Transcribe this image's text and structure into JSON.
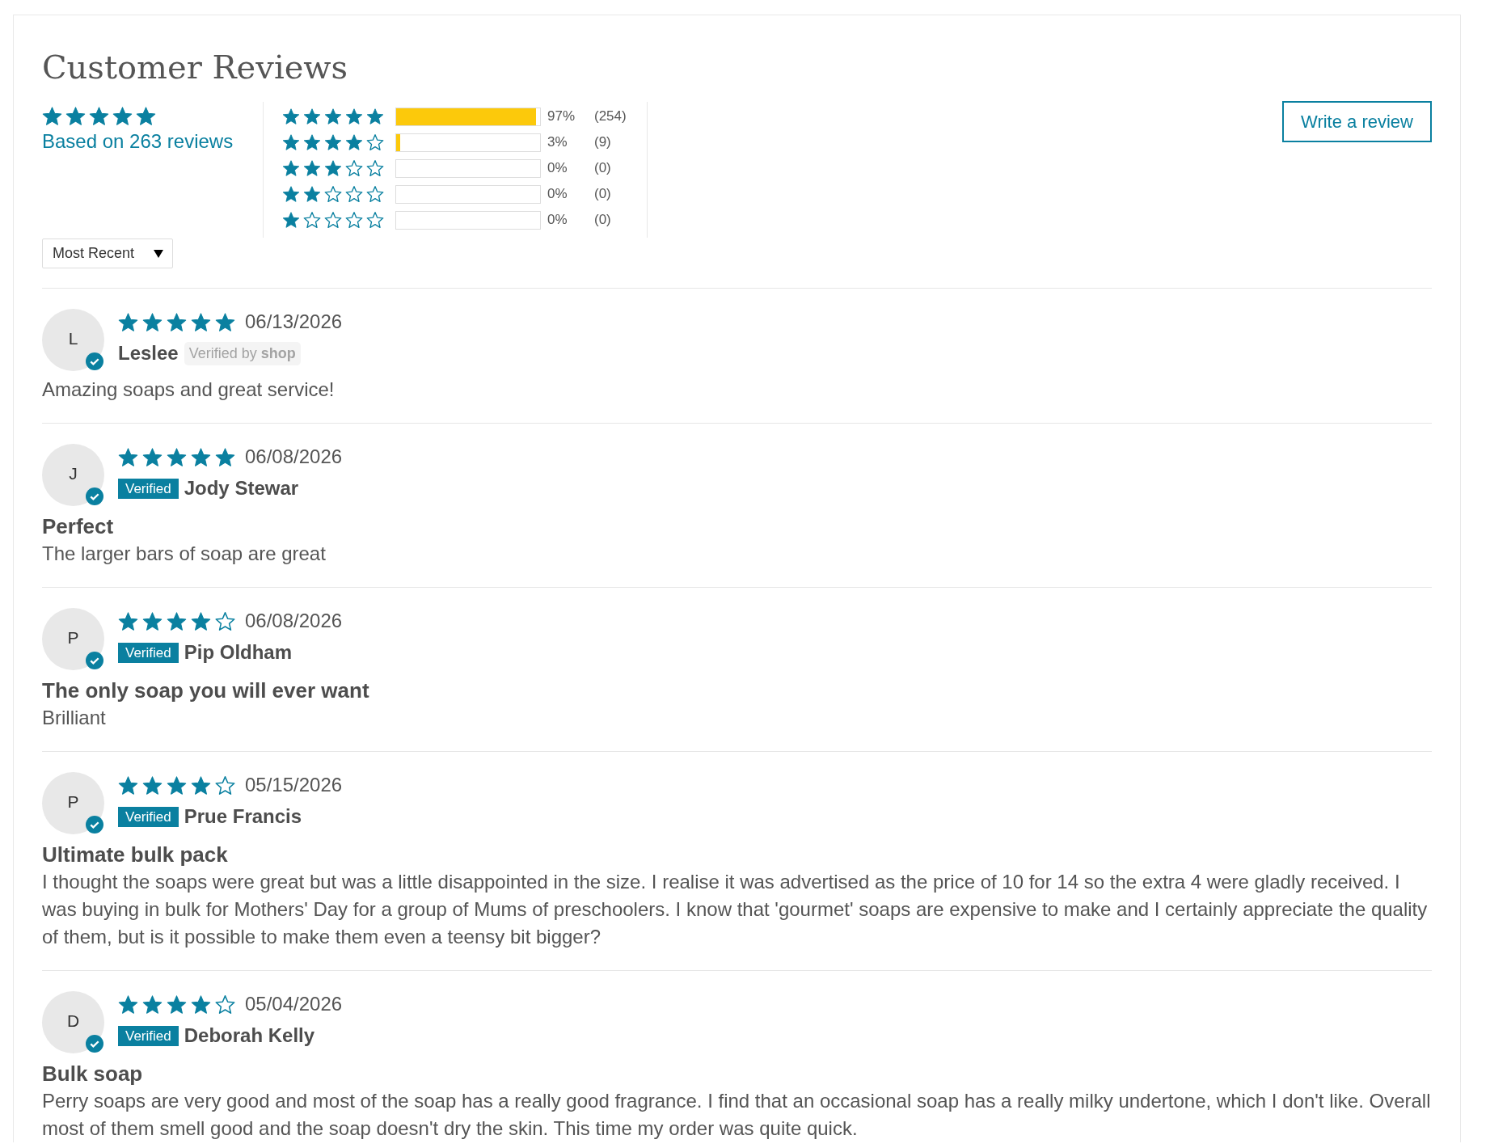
{
  "title": "Customer Reviews",
  "summary": {
    "stars": 5,
    "caption": "Based on 263 reviews"
  },
  "histogram": [
    {
      "stars": 5,
      "level": 0.97,
      "percent": "97%",
      "count": "(254)"
    },
    {
      "stars": 4,
      "level": 0.03,
      "percent": "3%",
      "count": "(9)"
    },
    {
      "stars": 3,
      "level": 0,
      "percent": "0%",
      "count": "(0)"
    },
    {
      "stars": 2,
      "level": 0,
      "percent": "0%",
      "count": "(0)"
    },
    {
      "stars": 1,
      "level": 0,
      "percent": "0%",
      "count": "(0)"
    }
  ],
  "write_review_button": "Write a review",
  "sort": {
    "value": "Most Recent"
  },
  "reviews": [
    {
      "initial": "L",
      "verified": true,
      "stars": 5,
      "date": "06/13/2026",
      "name": "Leslee",
      "badge": {
        "kind": "shop",
        "text": "Verified by **shop**"
      },
      "body": "Amazing soaps and great service!"
    },
    {
      "initial": "J",
      "verified": true,
      "stars": 5,
      "date": "06/08/2026",
      "name": "Jody Stewar",
      "badge": {
        "kind": "verified",
        "text": "Verified"
      },
      "title": "Perfect",
      "body": "The larger bars of soap are great"
    },
    {
      "initial": "P",
      "verified": true,
      "stars": 4,
      "date": "06/08/2026",
      "name": "Pip Oldham",
      "badge": {
        "kind": "verified",
        "text": "Verified"
      },
      "title": "The only soap you will ever want",
      "body": "Brilliant"
    },
    {
      "initial": "P",
      "verified": true,
      "stars": 4,
      "date": "05/15/2026",
      "name": "Prue Francis",
      "badge": {
        "kind": "verified",
        "text": "Verified"
      },
      "title": "Ultimate bulk pack",
      "body": "I thought the soaps were great but was a little disappointed in the size. I realise it was advertised as the price of 10 for 14 so the extra 4 were gladly received. I was buying in bulk for Mothers' Day for a group of Mums of preschoolers. I know that 'gourmet' soaps are expensive to make and I certainly appreciate the quality of them, but is it possible to make them even a teensy bit bigger?"
    },
    {
      "initial": "D",
      "verified": true,
      "stars": 4,
      "date": "05/04/2026",
      "name": "Deborah Kelly",
      "badge": {
        "kind": "verified",
        "text": "Verified"
      },
      "title": "Bulk soap",
      "body": "Perry soaps are very good and most of the soap has a really good fragrance. I find that an occasional soap has a really milky undertone, which I don't like. Overall most of them smell good and the soap doesn't dry the skin. This time my order was quite quick."
    }
  ]
}
